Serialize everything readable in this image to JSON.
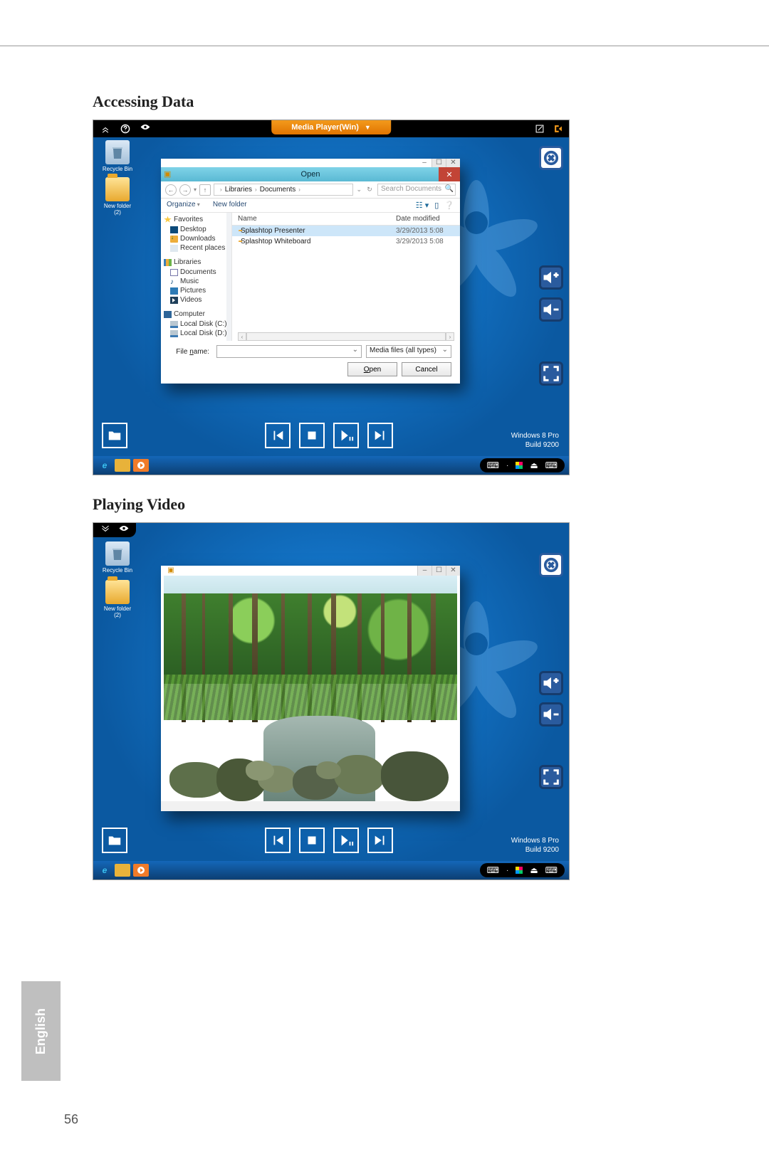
{
  "page_number": "56",
  "language_tab": "English",
  "section1_title": "Accessing Data",
  "section2_title": "Playing Video",
  "remote_top": {
    "center_tab_label": "Media Player(Win)"
  },
  "desktop_icons": {
    "recycle_bin": "Recycle Bin",
    "new_folder": "New folder (2)"
  },
  "open_dialog": {
    "title": "Open",
    "breadcrumb_1": "Libraries",
    "breadcrumb_2": "Documents",
    "search_placeholder": "Search Documents",
    "toolbar_organize": "Organize",
    "toolbar_newfolder": "New folder",
    "col_name": "Name",
    "col_date": "Date modified",
    "tree": {
      "favorites": "Favorites",
      "desktop": "Desktop",
      "downloads": "Downloads",
      "recent": "Recent places",
      "libraries": "Libraries",
      "documents": "Documents",
      "music": "Music",
      "pictures": "Pictures",
      "videos": "Videos",
      "computer": "Computer",
      "disk_c": "Local Disk (C:)",
      "disk_d": "Local Disk (D:)"
    },
    "files": [
      {
        "name": "Splashtop Presenter",
        "date": "3/29/2013 5:08"
      },
      {
        "name": "Splashtop Whiteboard",
        "date": "3/29/2013 5:08"
      }
    ],
    "filename_label_prefix": "File ",
    "filename_label_underline": "n",
    "filename_label_suffix": "ame:",
    "filetype_value": "Media files (all types)",
    "btn_open_underline": "O",
    "btn_open_rest": "pen",
    "btn_cancel": "Cancel"
  },
  "watermark": {
    "line1": "Windows 8 Pro",
    "line2": "Build 9200"
  }
}
